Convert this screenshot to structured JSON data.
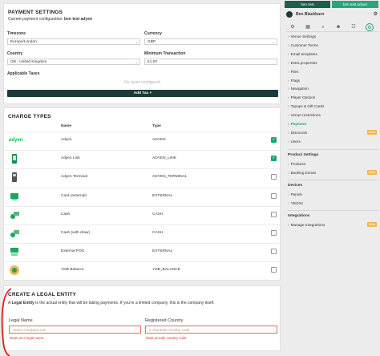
{
  "payment_settings": {
    "title": "PAYMENT SETTINGS",
    "config_prefix": "Current payment configuration:",
    "config_name": "ben test adyen",
    "timezone_label": "Timezone",
    "timezone_value": "Europe/London",
    "currency_label": "Currency",
    "currency_value": "GBP",
    "country_label": "Country",
    "country_value": "GB - United Kingdom",
    "min_tx_label": "Minimum Transaction",
    "min_tx_value": "£1.00",
    "taxes_label": "Applicable Taxes",
    "no_taxes": "No taxes configured.",
    "add_tax": "Add Tax +"
  },
  "charge_types": {
    "title": "CHARGE TYPES",
    "col_name": "Name",
    "col_type": "Type",
    "rows": [
      {
        "logo": "adyen-logo",
        "logo_text": "adyen",
        "name": "Adyen",
        "type": "ADYEN",
        "checked": true
      },
      {
        "logo": "adyen-link-icon",
        "logo_text": "",
        "name": "Adyen Link",
        "type": "ADYEN_LINK",
        "checked": true
      },
      {
        "logo": "card-terminal-icon",
        "logo_text": "",
        "name": "Adyen Terminal",
        "type": "ADYEN_TERMINAL",
        "checked": false
      },
      {
        "logo": "card-external-icon",
        "logo_text": "",
        "name": "Card (external)",
        "type": "EXTERNAL",
        "checked": false
      },
      {
        "logo": "cash-icon",
        "logo_text": "",
        "name": "Cash",
        "type": "CASH",
        "checked": false
      },
      {
        "logo": "cash-withdraw-icon",
        "logo_text": "",
        "name": "Cash (with draw)",
        "type": "CASH",
        "checked": false
      },
      {
        "logo": "external-pos-icon",
        "logo_text": "",
        "name": "External POS",
        "type": "EXTERNAL",
        "checked": false
      },
      {
        "logo": "ydb-balance-icon",
        "logo_text": "",
        "name": "YDB Balance",
        "type": "YDB_BALANCE",
        "checked": false
      }
    ]
  },
  "legal_entity": {
    "title": "CREATE A LEGAL ENTITY",
    "desc_prefix": "A",
    "desc_bold": "Legal Entity",
    "desc_rest": "is the actual entity that will be taking payments. If you're a limited company, this is the company itself.",
    "legal_name_label": "Legal Name",
    "legal_name_placeholder": "Some Company Ltd.",
    "legal_name_error": "Must set a legal name.",
    "country_label": "Registered Country",
    "country_placeholder": "2 character country code",
    "country_error": "Must provide country code."
  },
  "sidebar": {
    "tab_left": "ben test",
    "tab_right": "ben test adyen",
    "user_name": "Ben Blackburn",
    "nav_icons": [
      "settings-icon",
      "store-icon",
      "search-icon",
      "users-icon",
      "group-icon",
      "gear-icon"
    ],
    "items": [
      {
        "label": "Venue Settings"
      },
      {
        "label": "Customer Terms"
      },
      {
        "label": "Email templates"
      },
      {
        "label": "Extra properties"
      },
      {
        "label": "Files"
      },
      {
        "label": "Flags"
      },
      {
        "label": "Navigation"
      },
      {
        "label": "Player Options"
      },
      {
        "label": "Topups & Gift Cards"
      },
      {
        "label": "Venue restrictions"
      },
      {
        "label": "Payment"
      },
      {
        "label": "Discounts"
      },
      {
        "label": "Users"
      }
    ],
    "beta_label": "Beta",
    "product_settings": "Product Settings",
    "product_items": [
      {
        "label": "Products"
      },
      {
        "label": "Booking Extras"
      }
    ],
    "devices": "Devices",
    "device_items": [
      {
        "label": "Panels"
      },
      {
        "label": "YBOXs"
      }
    ],
    "integrations": "Integrations",
    "integration_items": [
      {
        "label": "Manage Integrations"
      }
    ],
    "accent": "#17a57a"
  }
}
